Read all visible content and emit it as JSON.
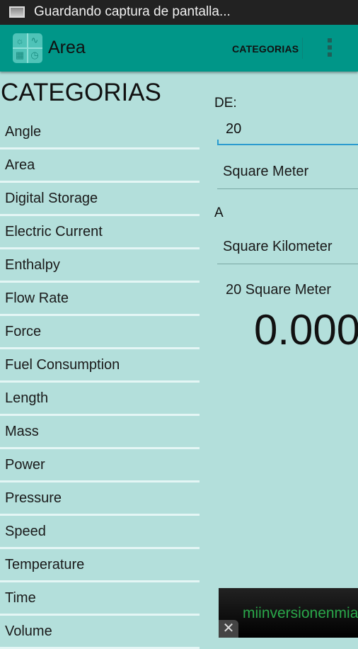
{
  "statusbar": {
    "icon": "screenshot-icon",
    "message": "Guardando captura de pantalla..."
  },
  "actionbar": {
    "app_icon": "unit-converter-app-icon",
    "title": "Area",
    "action_label": "CATEGORIAS",
    "overflow_icon": "more-vert-icon",
    "color": "#009688"
  },
  "categories": {
    "title": "CATEGORIAS",
    "items": [
      {
        "label": "Angle"
      },
      {
        "label": "Area"
      },
      {
        "label": "Digital Storage"
      },
      {
        "label": "Electric Current"
      },
      {
        "label": "Enthalpy"
      },
      {
        "label": "Flow Rate"
      },
      {
        "label": "Force"
      },
      {
        "label": "Fuel Consumption"
      },
      {
        "label": "Length"
      },
      {
        "label": "Mass"
      },
      {
        "label": "Power"
      },
      {
        "label": "Pressure"
      },
      {
        "label": "Speed"
      },
      {
        "label": "Temperature"
      },
      {
        "label": "Time"
      },
      {
        "label": "Volume"
      }
    ]
  },
  "converter": {
    "from_label": "DE:",
    "input_value": "20",
    "from_unit": "Square Meter",
    "to_label": "A",
    "to_unit": "Square Kilometer",
    "source_text": "20 Square Meter",
    "result": "0.000"
  },
  "ad": {
    "text": "miinversionenmia",
    "close_icon": "close-icon",
    "text_color": "#2aa84a"
  },
  "colors": {
    "background": "#b3dfdb",
    "accent": "#2b9bcf"
  }
}
